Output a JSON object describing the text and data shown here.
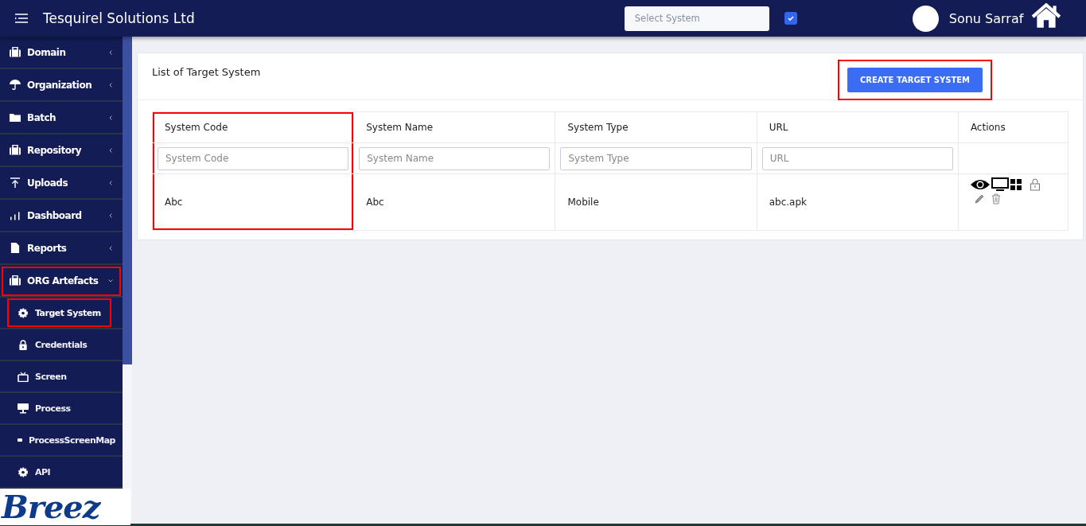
{
  "header": {
    "title": "Tesquirel Solutions Ltd",
    "system_select": {
      "placeholder": "Select System"
    },
    "checkbox": {
      "checked": true
    },
    "user_name": "Sonu Sarraf"
  },
  "sidebar": {
    "items": [
      {
        "label": "Domain",
        "expanded": false,
        "highlighted": false
      },
      {
        "label": "Organization",
        "expanded": false,
        "highlighted": false
      },
      {
        "label": "Batch",
        "expanded": false,
        "highlighted": false
      },
      {
        "label": "Repository",
        "expanded": false,
        "highlighted": false
      },
      {
        "label": "Uploads",
        "expanded": false,
        "highlighted": false
      },
      {
        "label": "Dashboard",
        "expanded": false,
        "highlighted": false
      },
      {
        "label": "Reports",
        "expanded": false,
        "highlighted": false
      },
      {
        "label": "ORG Artefacts",
        "expanded": true,
        "highlighted": true,
        "children": [
          {
            "label": "Target System",
            "selected": true,
            "highlighted": true
          },
          {
            "label": "Credentials",
            "selected": false,
            "highlighted": false
          },
          {
            "label": "Screen",
            "selected": false,
            "highlighted": false
          },
          {
            "label": "Process",
            "selected": false,
            "highlighted": false
          },
          {
            "label": "ProcessScreenMap",
            "selected": false,
            "highlighted": false
          },
          {
            "label": "API",
            "selected": false,
            "highlighted": false
          }
        ]
      }
    ],
    "logo": "Breez"
  },
  "card": {
    "title": "List of Target System",
    "create_button": {
      "label": "CREATE TARGET SYSTEM",
      "highlighted": true
    },
    "table": {
      "columns": [
        {
          "label": "System Code",
          "filter_placeholder": "System Code",
          "highlighted": true
        },
        {
          "label": "System Name",
          "filter_placeholder": "System Name",
          "highlighted": false
        },
        {
          "label": "System Type",
          "filter_placeholder": "System Type",
          "highlighted": false
        },
        {
          "label": "URL",
          "filter_placeholder": "URL",
          "highlighted": false
        },
        {
          "label": "Actions",
          "highlighted": false
        }
      ],
      "rows": [
        {
          "cells": [
            "Abc",
            "Abc",
            "Mobile",
            "abc.apk"
          ]
        }
      ]
    }
  }
}
